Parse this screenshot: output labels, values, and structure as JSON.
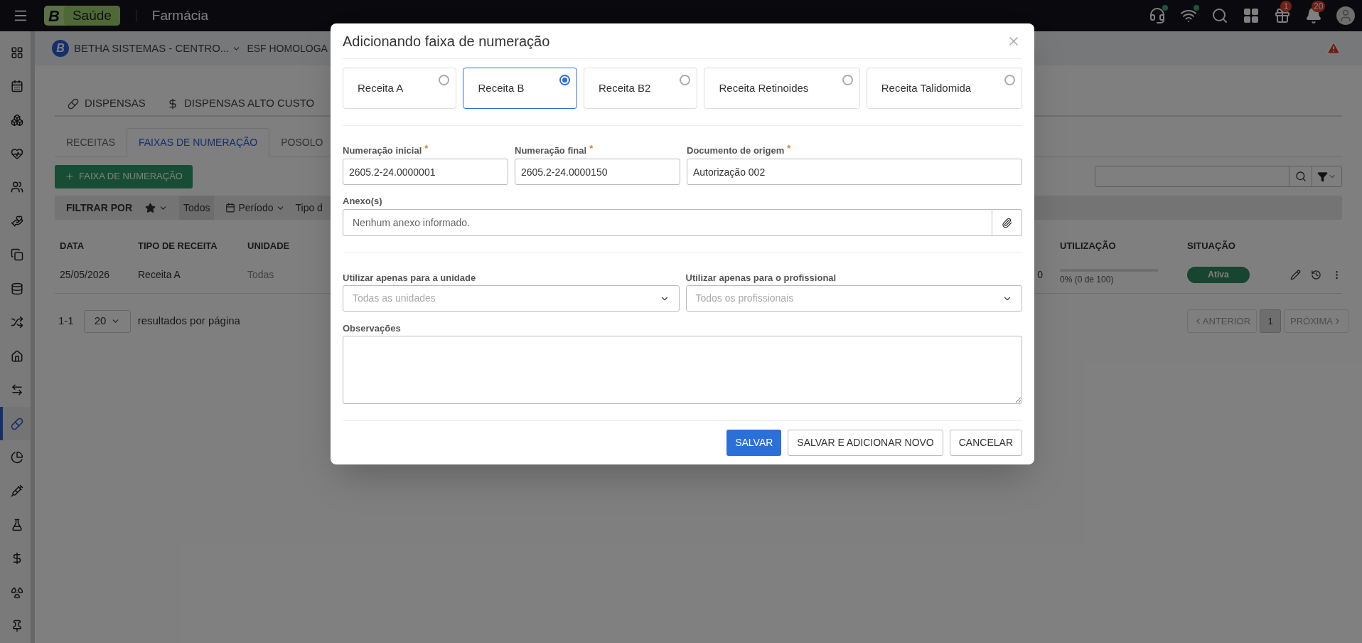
{
  "topbar": {
    "logo_letter": "B",
    "logo_text": "Saúde",
    "app_title": "Farmácia",
    "badges": [
      {
        "count": "1"
      },
      {
        "count": "20"
      }
    ]
  },
  "sidebar": {
    "items": [
      {
        "selected": false
      },
      {
        "selected": false
      },
      {
        "selected": false
      },
      {
        "selected": false
      },
      {
        "selected": false
      },
      {
        "selected": false
      },
      {
        "selected": false
      },
      {
        "selected": false
      },
      {
        "selected": false
      },
      {
        "selected": false
      },
      {
        "selected": false
      },
      {
        "selected": true
      },
      {
        "selected": false
      },
      {
        "selected": false
      },
      {
        "selected": false
      },
      {
        "selected": false
      },
      {
        "selected": false
      },
      {
        "selected": false
      }
    ]
  },
  "breadcrumb": {
    "logo_letter": "B",
    "entity": "BETHA SISTEMAS - CENTRO...",
    "unit": "ESF HOMOLOGA"
  },
  "main_tabs": [
    {
      "label": "DISPENSAS",
      "selected": false
    },
    {
      "label": "DISPENSAS ALTO CUSTO",
      "selected": false
    }
  ],
  "sub_tabs": [
    {
      "label": "RECEITAS",
      "selected": false
    },
    {
      "label": "FAIXAS DE NUMERAÇÃO",
      "selected": true
    },
    {
      "label": "POSOLO",
      "selected": false
    }
  ],
  "add_button": "FAIXA DE NUMERAÇÃO",
  "filter_bar": {
    "label": "FILTRAR POR",
    "favorite": "Todos",
    "period": "Período",
    "type": "Tipo d"
  },
  "table": {
    "columns": [
      "DATA",
      "TIPO DE RECEITA",
      "UNIDADE",
      "UTILIZAÇÃO",
      "SITUAÇÃO"
    ],
    "rows": [
      {
        "data": "25/05/2026",
        "tipo": "Receita A",
        "unidade": "Todas",
        "column_4": "0",
        "utilizacao": {
          "level": 0,
          "text": "0% (0 de 100)"
        },
        "situacao": "Ativa"
      }
    ]
  },
  "pagination": {
    "range": "1-1",
    "page_size": "20",
    "page_size_label": "resultados por página",
    "previous": "ANTERIOR",
    "pages": [
      {
        "label": "1",
        "selected": true
      }
    ],
    "next": "PRÓXIMA"
  },
  "dialog": {
    "title": "Adicionando faixa de numeração",
    "options": [
      {
        "label": "Receita A",
        "selected": false
      },
      {
        "label": "Receita B",
        "selected": true
      },
      {
        "label": "Receita B2",
        "selected": false
      },
      {
        "label": "Receita Retinoides",
        "selected": false
      },
      {
        "label": "Receita Talidomida",
        "selected": false
      }
    ],
    "number_fields": [
      {
        "label": "Numeração inicial",
        "required_mark": "*",
        "value": "2605.2-24.0000001"
      },
      {
        "label": "Numeração final",
        "required_mark": "*",
        "value": "2605.2-24.0000150"
      },
      {
        "label": "Documento de origem",
        "required_mark": "*",
        "value": "Autorização 002"
      }
    ],
    "attachments": {
      "label": "Anexo(s)",
      "placeholder": "Nenhum anexo informado."
    },
    "selects": [
      {
        "label": "Utilizar apenas para a unidade",
        "placeholder": "Todas as unidades"
      },
      {
        "label": "Utilizar apenas para o profissional",
        "placeholder": "Todos os profissionais"
      }
    ],
    "notes": {
      "label": "Observações"
    },
    "buttons": [
      {
        "label": "SALVAR",
        "kind": "primary"
      },
      {
        "label": "SALVAR E ADICIONAR NOVO",
        "kind": "secondary"
      },
      {
        "label": "CANCELAR",
        "kind": "secondary"
      }
    ]
  }
}
